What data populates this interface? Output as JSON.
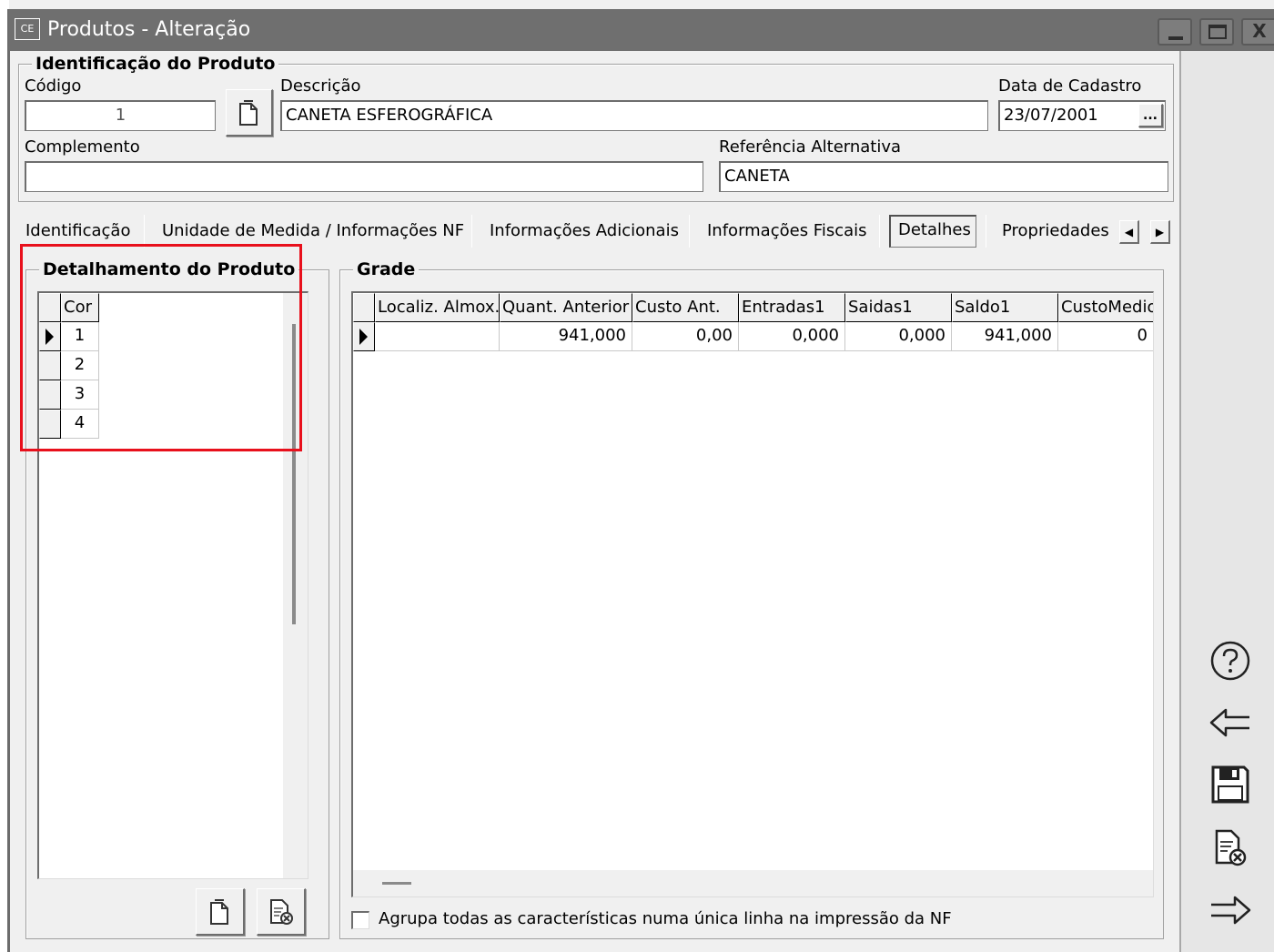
{
  "window": {
    "title": "Produtos - Alteração",
    "icon_text": "CE",
    "minimize": "_",
    "maximize": "□",
    "close": "X"
  },
  "ident": {
    "legend": "Identificação do Produto",
    "codigo_label": "Código",
    "codigo_value": "1",
    "descricao_label": "Descrição",
    "descricao_value": "CANETA ESFEROGRÁFICA",
    "data_label": "Data de Cadastro",
    "data_value": "23/07/2001",
    "data_button": "...",
    "complemento_label": "Complemento",
    "complemento_value": "",
    "ref_label": "Referência Alternativa",
    "ref_value": "CANETA"
  },
  "tabs": {
    "items": [
      "Identificação",
      "Unidade de Medida / Informações NF",
      "Informações Adicionais",
      "Informações Fiscais",
      "Detalhes",
      "Propriedades"
    ],
    "active": "Detalhes",
    "prev": "◀",
    "next": "▶"
  },
  "detalhamento": {
    "legend": "Detalhamento do Produto",
    "header": "Cor",
    "rows": [
      "1",
      "2",
      "3",
      "4"
    ]
  },
  "grade": {
    "legend": "Grade",
    "headers": [
      "Localiz. Almox.",
      "Quant. Anterior",
      "Custo Ant.",
      "Entradas1",
      "Saidas1",
      "Saldo1",
      "CustoMedio"
    ],
    "row": [
      "",
      "941,000",
      "0,00",
      "0,000",
      "0,000",
      "941,000",
      "0"
    ],
    "checkbox_label": "Agrupa todas as características numa única linha na impressão da NF",
    "checkbox_checked": false
  },
  "side_icons": [
    "help-icon",
    "back-arrow-icon",
    "save-icon",
    "cancel-document-icon",
    "forward-arrow-icon"
  ],
  "colors": {
    "titlebar": "#6f6f6f",
    "highlight": "#e8101c",
    "background": "#f0f0f0"
  }
}
